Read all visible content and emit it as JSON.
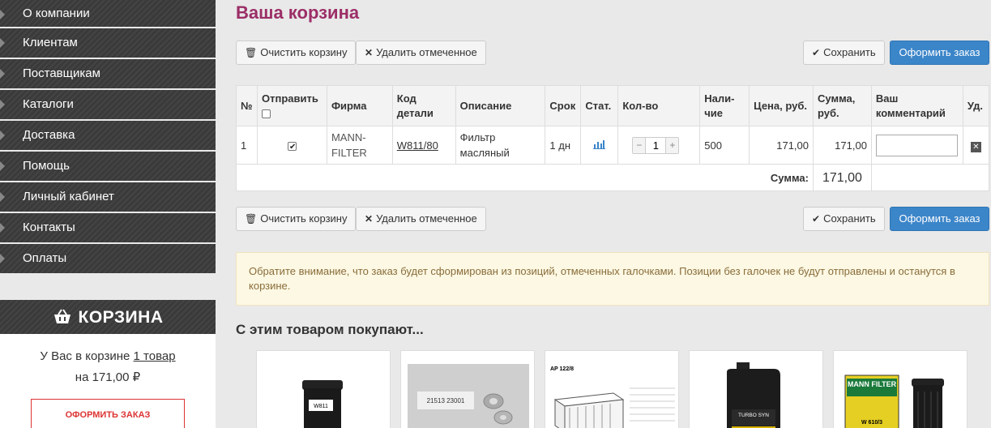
{
  "sidebar": {
    "items": [
      {
        "label": "О компании"
      },
      {
        "label": "Клиентам"
      },
      {
        "label": "Поставщикам"
      },
      {
        "label": "Каталоги"
      },
      {
        "label": "Доставка"
      },
      {
        "label": "Помощь"
      },
      {
        "label": "Личный кабинет"
      },
      {
        "label": "Контакты"
      },
      {
        "label": "Оплаты"
      }
    ]
  },
  "mini_cart": {
    "title": "КОРЗИНА",
    "line1_prefix": "У Вас в корзине ",
    "line1_link": "1 товар",
    "line2": "на 171,00 ₽",
    "order_button": "ОФОРМИТЬ ЗАКАЗ",
    "icon": "basket-icon"
  },
  "page": {
    "title": "Ваша корзина"
  },
  "toolbar": {
    "clear_label": "Очистить корзину",
    "delete_label": "Удалить отмеченное",
    "save_label": "Сохранить",
    "order_label": "Оформить заказ"
  },
  "table": {
    "headers": {
      "num": "№",
      "send": "Отправить",
      "firm": "Фирма",
      "code_line1": "Код",
      "code_line2": "детали",
      "desc": "Описание",
      "term": "Срок",
      "stat": "Стат.",
      "qty": "Кол-во",
      "avail_line1": "Нали-",
      "avail_line2": "чие",
      "price": "Цена, руб.",
      "sum_line1": "Сумма,",
      "sum_line2": "руб.",
      "comment_line1": "Ваш",
      "comment_line2": "комментарий",
      "del": "Уд."
    },
    "rows": [
      {
        "num": "1",
        "send_checked": true,
        "firm_line1": "MANN-",
        "firm_line2": "FILTER",
        "code": "W811/80",
        "desc_line1": "Фильтр",
        "desc_line2": "масляный",
        "term": "1 дн",
        "qty": "1",
        "avail": "500",
        "price": "171,00",
        "sum": "171,00",
        "comment": ""
      }
    ],
    "total_label": "Сумма:",
    "total_value": "171,00"
  },
  "notice": "Обратите внимание, что заказ будет сформирован из позиций, отмеченных галочками. Позиции без галочек не будут отправлены и останутся в корзине.",
  "related": {
    "title": "С этим товаром покупают...",
    "products": [
      {
        "image": "oil-filter-image",
        "label": "W811"
      },
      {
        "image": "gasket-pack-image",
        "label": "21513 23001"
      },
      {
        "image": "air-filter-image",
        "label": "AP 122/8"
      },
      {
        "image": "motor-oil-can-image",
        "label": "TURBO SYN"
      },
      {
        "image": "mann-filter-box-image",
        "brand": "MANN FILTER",
        "label": "W 610/3"
      }
    ]
  },
  "colors": {
    "accent": "#9b2e67",
    "primary": "#3b85c9",
    "cta_red": "#d33333"
  }
}
